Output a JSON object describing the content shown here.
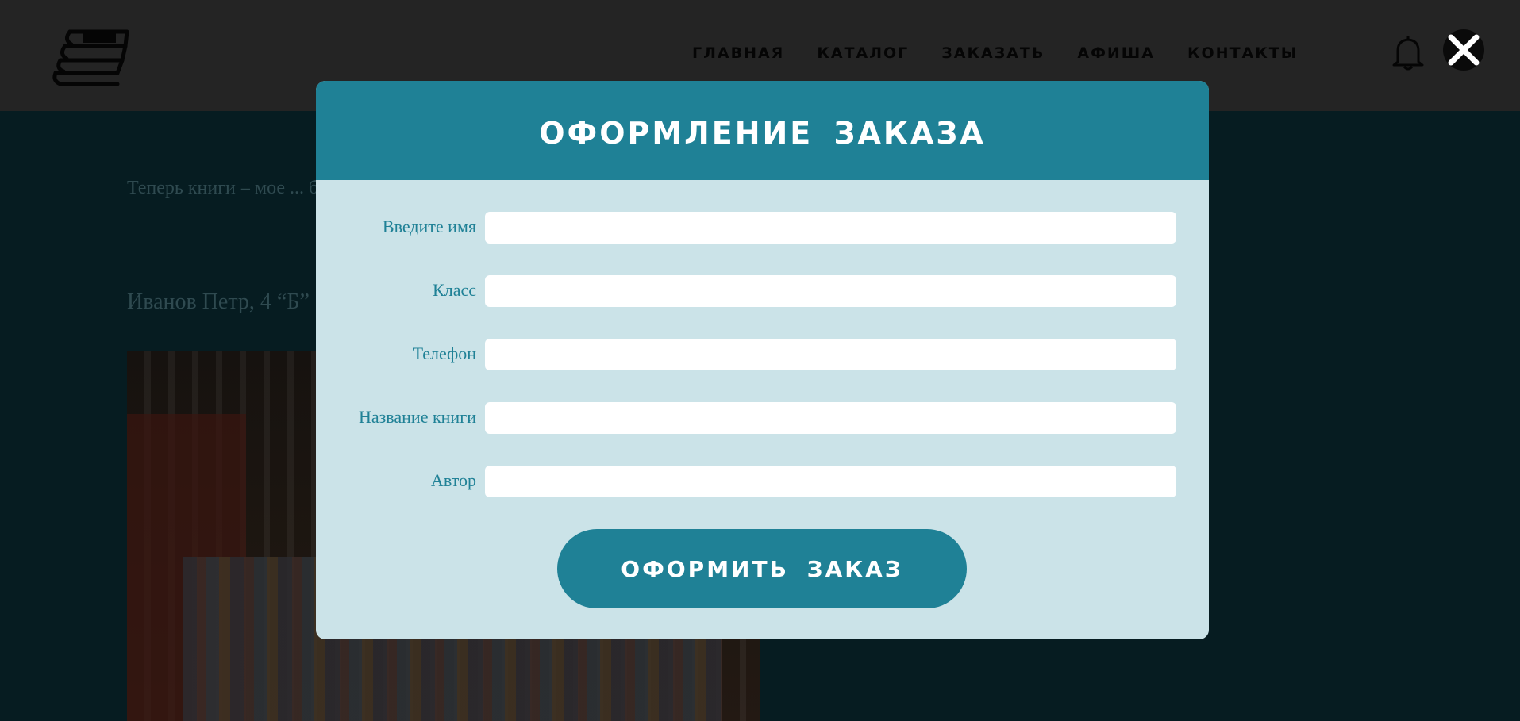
{
  "header": {
    "nav": [
      {
        "label": "ГЛАВНАЯ"
      },
      {
        "label": "КАТАЛОГ"
      },
      {
        "label": "ЗАКАЗАТЬ"
      },
      {
        "label": "АФИША"
      },
      {
        "label": "КОНТАКТЫ"
      }
    ],
    "icons": [
      "books-logo-icon",
      "bell-icon",
      "close-icon"
    ]
  },
  "background": {
    "review_text": "Теперь книги – мое ... библиотеку. Читать стало гораздо интере... возможность открывать для себя н...",
    "review_author": "Иванов Петр, 4 “Б”"
  },
  "modal": {
    "title": "ОФОРМЛЕНИЕ ЗАКАЗА",
    "fields": [
      {
        "label": "Введите имя",
        "value": ""
      },
      {
        "label": "Класс",
        "value": ""
      },
      {
        "label": "Телефон",
        "value": ""
      },
      {
        "label": "Название книги",
        "value": ""
      },
      {
        "label": "Автор",
        "value": ""
      }
    ],
    "submit_label": "ОФОРМИТЬ ЗАКАЗ"
  },
  "colors": {
    "accent": "#1f8196",
    "modal_body": "#cbe3e8",
    "header_dim": "#242424",
    "overlay": "#061c21"
  }
}
